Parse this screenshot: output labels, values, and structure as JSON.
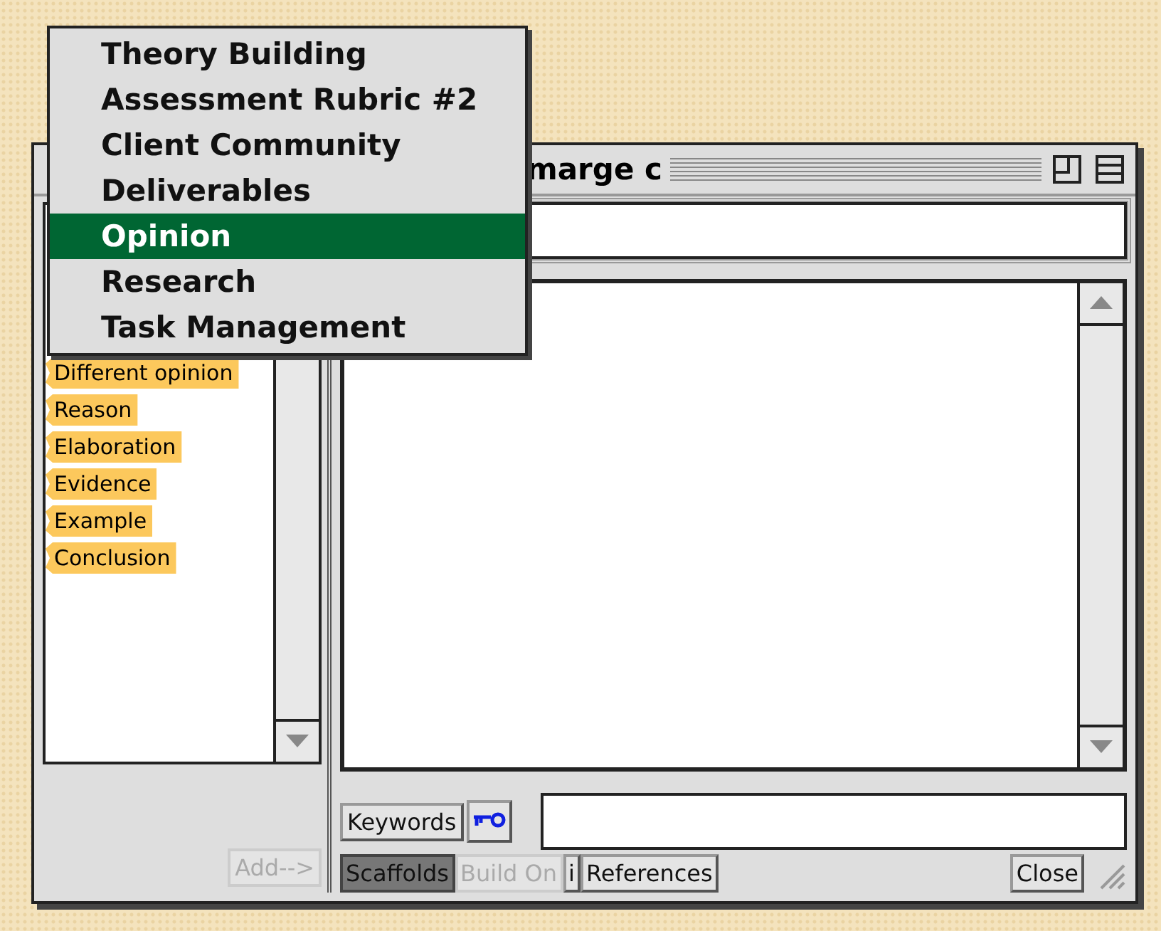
{
  "menu": {
    "items": [
      {
        "label": "Theory Building",
        "selected": false
      },
      {
        "label": "Assessment Rubric #2",
        "selected": false
      },
      {
        "label": "Client Community",
        "selected": false
      },
      {
        "label": "Deliverables",
        "selected": false
      },
      {
        "label": "Opinion",
        "selected": true
      },
      {
        "label": "Research",
        "selected": false
      },
      {
        "label": "Task Management",
        "selected": false
      }
    ]
  },
  "window": {
    "title": "marge c"
  },
  "scaffolds": [
    {
      "label": "Different opinion"
    },
    {
      "label": "Reason"
    },
    {
      "label": "Elaboration"
    },
    {
      "label": "Evidence"
    },
    {
      "label": "Example"
    },
    {
      "label": "Conclusion"
    }
  ],
  "add_button": {
    "label": "Add-->",
    "disabled": true
  },
  "keywords_button": {
    "label": "Keywords"
  },
  "bottom_buttons": [
    {
      "label": "Scaffolds",
      "selected": true,
      "disabled": false
    },
    {
      "label": "Build On",
      "selected": false,
      "disabled": true
    },
    {
      "label": "i",
      "selected": false,
      "disabled": false
    },
    {
      "label": "References",
      "selected": false,
      "disabled": false
    }
  ],
  "close_button": {
    "label": "Close"
  }
}
